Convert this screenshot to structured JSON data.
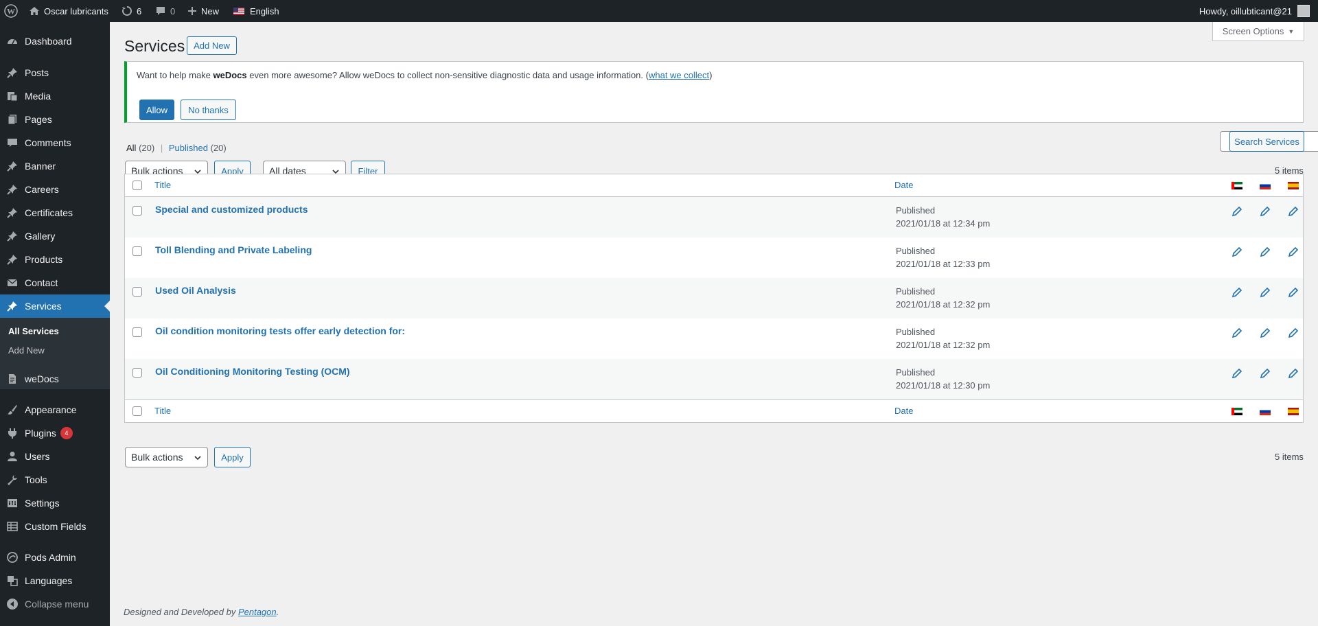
{
  "adminbar": {
    "site_name": "Oscar lubricants",
    "updates_count": "6",
    "comments_count": "0",
    "new_label": "New",
    "language": "English",
    "howdy": "Howdy, oillubticant@21"
  },
  "sidebar": {
    "items": [
      {
        "label": "Dashboard",
        "icon": "dashboard-icon"
      },
      {
        "label": "Posts",
        "icon": "pin-icon"
      },
      {
        "label": "Media",
        "icon": "media-icon"
      },
      {
        "label": "Pages",
        "icon": "pages-icon"
      },
      {
        "label": "Comments",
        "icon": "comments-icon"
      },
      {
        "label": "Banner",
        "icon": "pin-icon"
      },
      {
        "label": "Careers",
        "icon": "pin-icon"
      },
      {
        "label": "Certificates",
        "icon": "pin-icon"
      },
      {
        "label": "Gallery",
        "icon": "pin-icon"
      },
      {
        "label": "Products",
        "icon": "pin-icon"
      },
      {
        "label": "Contact",
        "icon": "mail-icon"
      },
      {
        "label": "Services",
        "icon": "pin-icon"
      },
      {
        "label": "weDocs",
        "icon": "docs-icon"
      },
      {
        "label": "Appearance",
        "icon": "brush-icon"
      },
      {
        "label": "Plugins",
        "icon": "plugin-icon",
        "badge": "4"
      },
      {
        "label": "Users",
        "icon": "users-icon"
      },
      {
        "label": "Tools",
        "icon": "wrench-icon"
      },
      {
        "label": "Settings",
        "icon": "settings-icon"
      },
      {
        "label": "Custom Fields",
        "icon": "table-icon"
      },
      {
        "label": "Pods Admin",
        "icon": "pods-icon"
      },
      {
        "label": "Languages",
        "icon": "translate-icon"
      },
      {
        "label": "Collapse menu",
        "icon": "collapse-icon"
      }
    ],
    "submenu": [
      "All Services",
      "Add New"
    ]
  },
  "header": {
    "title": "Services",
    "add_new": "Add New",
    "screen_options": "Screen Options"
  },
  "notice": {
    "text_before": "Want to help make ",
    "bold": "weDocs",
    "text_after": " even more awesome? Allow weDocs to collect non-sensitive diagnostic data and usage information. (",
    "link": "what we collect",
    "text_end": ")",
    "allow": "Allow",
    "no_thanks": "No thanks"
  },
  "filters": {
    "all_label": "All",
    "all_count": "(20)",
    "separator": "|",
    "published_label": "Published",
    "published_count": "(20)",
    "bulk_actions": "Bulk actions",
    "apply": "Apply",
    "all_dates": "All dates",
    "filter": "Filter",
    "search_button": "Search Services",
    "items_count": "5 items"
  },
  "table": {
    "col_title": "Title",
    "col_date": "Date",
    "rows": [
      {
        "title": "Special and customized products",
        "status": "Published",
        "date": "2021/01/18 at 12:34 pm"
      },
      {
        "title": "Toll Blending and Private Labeling",
        "status": "Published",
        "date": "2021/01/18 at 12:33 pm"
      },
      {
        "title": "Used Oil Analysis",
        "status": "Published",
        "date": "2021/01/18 at 12:32 pm"
      },
      {
        "title": "Oil condition monitoring tests offer early detection for:",
        "status": "Published",
        "date": "2021/01/18 at 12:32 pm"
      },
      {
        "title": "Oil Conditioning Monitoring Testing (OCM)",
        "status": "Published",
        "date": "2021/01/18 at 12:30 pm"
      }
    ]
  },
  "footer": {
    "text": "Designed and Developed by ",
    "link": "Pentagon",
    "end": "."
  },
  "colors": {
    "adminbar_bg": "#1d2327",
    "accent": "#2271b1",
    "notice_border": "#00a32a",
    "badge": "#d63638"
  }
}
